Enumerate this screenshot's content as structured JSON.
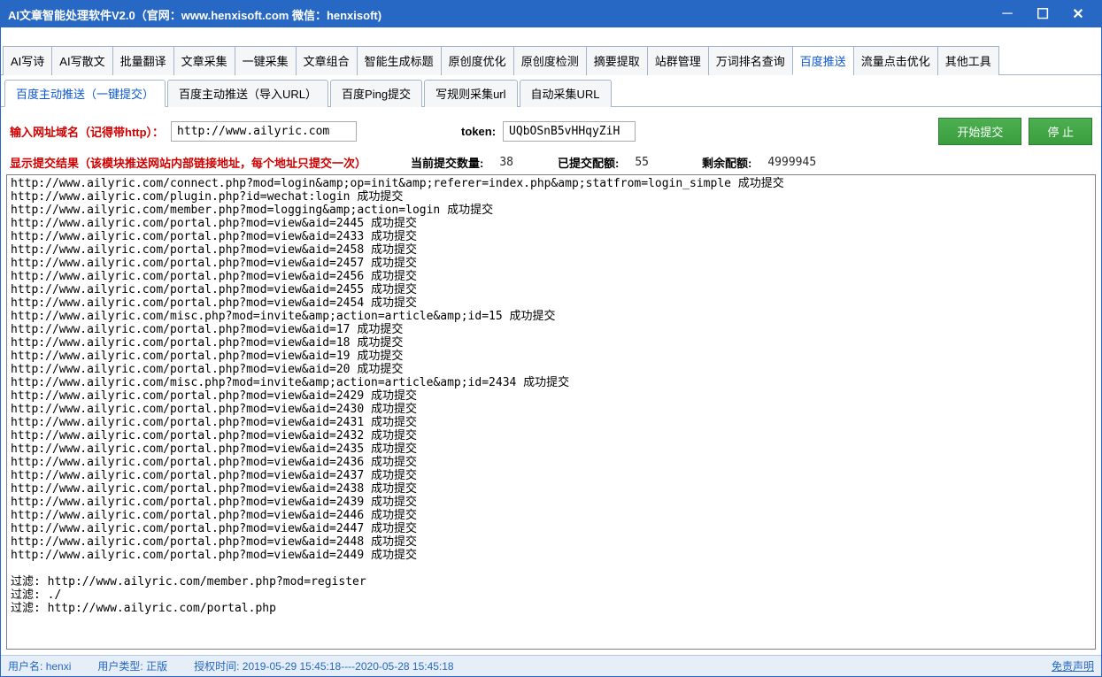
{
  "window": {
    "title": "AI文章智能处理软件V2.0（官网：www.henxisoft.com  微信：henxisoft)"
  },
  "mainTabs": [
    "AI写诗",
    "AI写散文",
    "批量翻译",
    "文章采集",
    "一键采集",
    "文章组合",
    "智能生成标题",
    "原创度优化",
    "原创度检测",
    "摘要提取",
    "站群管理",
    "万词排名查询",
    "百度推送",
    "流量点击优化",
    "其他工具"
  ],
  "mainTabActive": 12,
  "subTabs": [
    "百度主动推送（一键提交）",
    "百度主动推送（导入URL）",
    "百度Ping提交",
    "写规则采集url",
    "自动采集URL"
  ],
  "subTabActive": 0,
  "input": {
    "domainLabel": "输入网址域名（记得带http）：",
    "domainValue": "http://www.ailyric.com",
    "tokenLabel": "token:",
    "tokenValue": "UQbOSnB5vHHqyZiH",
    "startBtn": "开始提交",
    "stopBtn": "停 止"
  },
  "result": {
    "headerLabel": "显示提交结果（该模块推送网站内部链接地址，每个地址只提交一次）",
    "currentCountLabel": "当前提交数量:",
    "currentCount": "38",
    "submittedQuotaLabel": "已提交配额:",
    "submittedQuota": "55",
    "remainingQuotaLabel": "剩余配额:",
    "remainingQuota": "4999945"
  },
  "logLines": [
    "http://www.ailyric.com/connect.php?mod=login&amp;op=init&amp;referer=index.php&amp;statfrom=login_simple    成功提交",
    "http://www.ailyric.com/plugin.php?id=wechat:login    成功提交",
    "http://www.ailyric.com/member.php?mod=logging&amp;action=login    成功提交",
    "http://www.ailyric.com/portal.php?mod=view&aid=2445    成功提交",
    "http://www.ailyric.com/portal.php?mod=view&aid=2433    成功提交",
    "http://www.ailyric.com/portal.php?mod=view&aid=2458    成功提交",
    "http://www.ailyric.com/portal.php?mod=view&aid=2457    成功提交",
    "http://www.ailyric.com/portal.php?mod=view&aid=2456    成功提交",
    "http://www.ailyric.com/portal.php?mod=view&aid=2455    成功提交",
    "http://www.ailyric.com/portal.php?mod=view&aid=2454    成功提交",
    "http://www.ailyric.com/misc.php?mod=invite&amp;action=article&amp;id=15    成功提交",
    "http://www.ailyric.com/portal.php?mod=view&aid=17    成功提交",
    "http://www.ailyric.com/portal.php?mod=view&aid=18    成功提交",
    "http://www.ailyric.com/portal.php?mod=view&aid=19    成功提交",
    "http://www.ailyric.com/portal.php?mod=view&aid=20    成功提交",
    "http://www.ailyric.com/misc.php?mod=invite&amp;action=article&amp;id=2434    成功提交",
    "http://www.ailyric.com/portal.php?mod=view&aid=2429    成功提交",
    "http://www.ailyric.com/portal.php?mod=view&aid=2430    成功提交",
    "http://www.ailyric.com/portal.php?mod=view&aid=2431    成功提交",
    "http://www.ailyric.com/portal.php?mod=view&aid=2432    成功提交",
    "http://www.ailyric.com/portal.php?mod=view&aid=2435    成功提交",
    "http://www.ailyric.com/portal.php?mod=view&aid=2436    成功提交",
    "http://www.ailyric.com/portal.php?mod=view&aid=2437    成功提交",
    "http://www.ailyric.com/portal.php?mod=view&aid=2438    成功提交",
    "http://www.ailyric.com/portal.php?mod=view&aid=2439    成功提交",
    "http://www.ailyric.com/portal.php?mod=view&aid=2446    成功提交",
    "http://www.ailyric.com/portal.php?mod=view&aid=2447    成功提交",
    "http://www.ailyric.com/portal.php?mod=view&aid=2448    成功提交",
    "http://www.ailyric.com/portal.php?mod=view&aid=2449    成功提交",
    "",
    "过滤: http://www.ailyric.com/member.php?mod=register",
    "过滤: ./",
    "过滤: http://www.ailyric.com/portal.php"
  ],
  "status": {
    "userLabel": "用户名:",
    "userValue": "henxi",
    "typeLabel": "用户类型:",
    "typeValue": "正版",
    "authLabel": "授权时间:",
    "authValue": "2019-05-29 15:45:18----2020-05-28 15:45:18",
    "disclaimer": "免责声明"
  }
}
